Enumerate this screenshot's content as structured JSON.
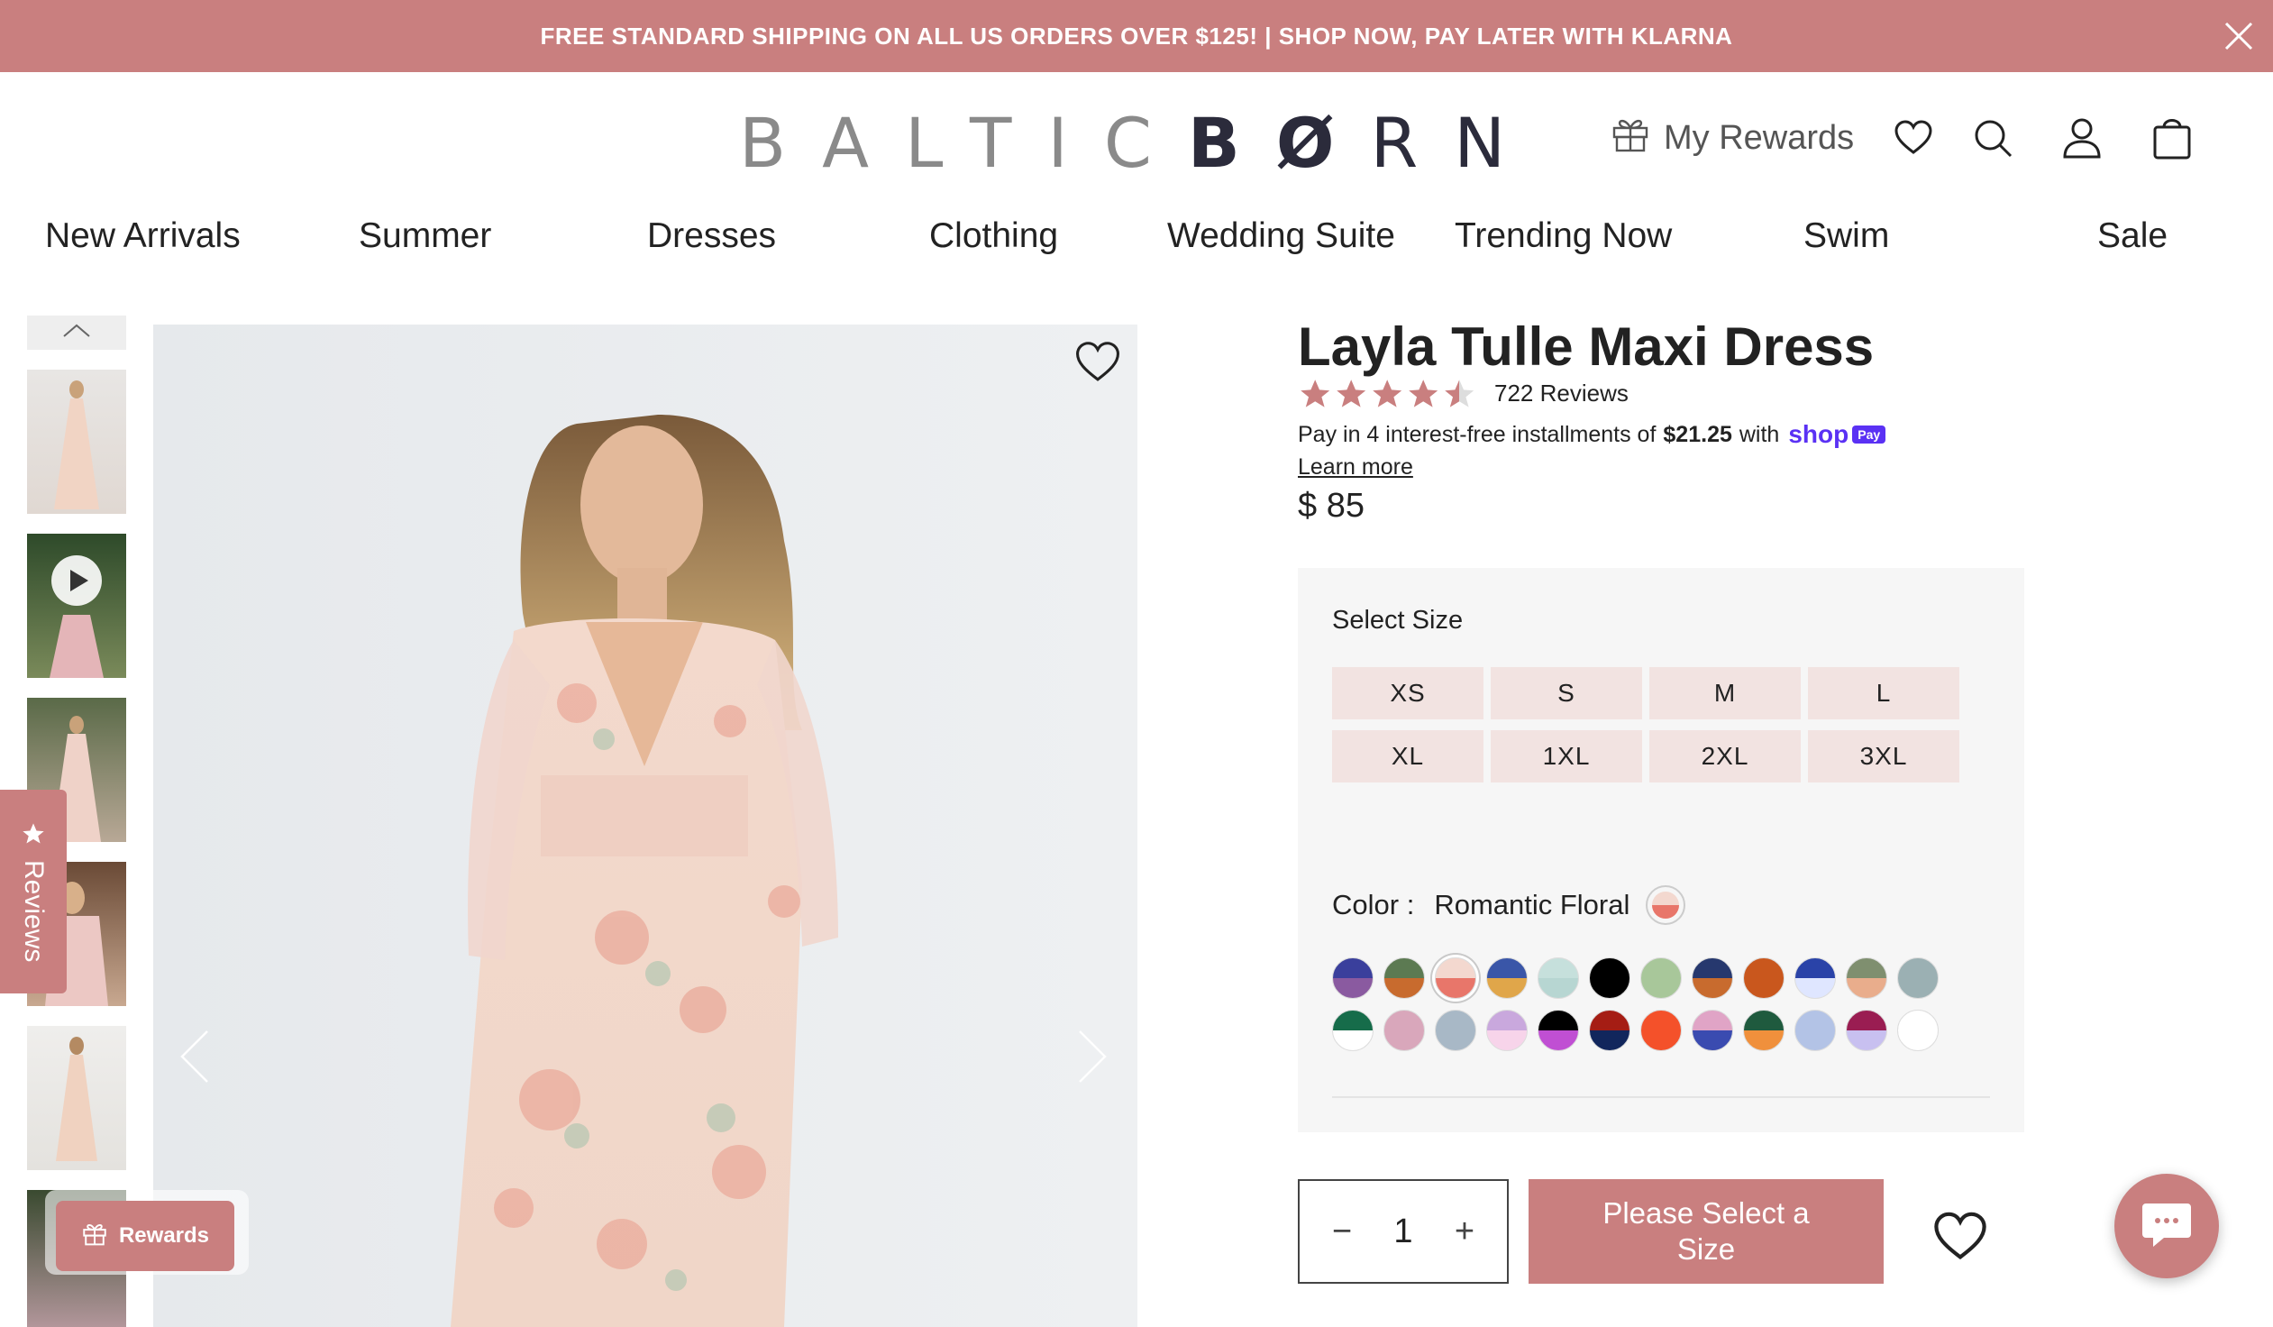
{
  "announcement": {
    "text": "FREE STANDARD SHIPPING ON ALL US ORDERS OVER $125! | SHOP NOW, PAY LATER WITH KLARNA",
    "bg_color": "#c97f7f"
  },
  "header": {
    "logo_light": "BALTIC",
    "logo_dark_1": "B",
    "logo_dark_2": "Ø",
    "logo_dark_3": "R",
    "logo_dark_4": "N",
    "rewards_label": "My Rewards",
    "icons": [
      "gift-icon",
      "heart-icon",
      "search-icon",
      "account-icon",
      "bag-icon"
    ]
  },
  "nav": {
    "items": [
      "New Arrivals",
      "Summer",
      "Dresses",
      "Clothing",
      "Wedding Suite",
      "Trending Now",
      "Swim",
      "Sale"
    ]
  },
  "reviews_tab": {
    "label": "Reviews"
  },
  "rewards_float": {
    "label": "Rewards"
  },
  "product": {
    "title": "Layla Tulle Maxi Dress",
    "rating": 4.5,
    "reviews_label": "722 Reviews",
    "installments_pre": "Pay in 4 interest-free installments of",
    "installments_amount": "$21.25",
    "installments_post": "with",
    "shop_logo": "shop",
    "shop_pay_badge": "Pay",
    "learn_more": "Learn more",
    "price": "$ 85"
  },
  "options": {
    "select_size_label": "Select Size",
    "sizes": [
      "XS",
      "S",
      "M",
      "L",
      "XL",
      "1XL",
      "2XL",
      "3XL"
    ],
    "color_label": "Color :",
    "color_value": "Romantic Floral",
    "swatches": [
      {
        "top": "#3a3f9c",
        "bottom": "#8a5aa0"
      },
      {
        "top": "#5c7a52",
        "bottom": "#c86b2e"
      },
      {
        "top": "#f3d8cf",
        "bottom": "#e8766a"
      },
      {
        "top": "#3a56a8",
        "bottom": "#e0a64a"
      },
      {
        "top": "#c6e0dc",
        "bottom": "#b7d6d2"
      },
      {
        "top": "#000000",
        "bottom": "#000000"
      },
      {
        "top": "#a8c79a",
        "bottom": "#a8c79a"
      },
      {
        "top": "#26386e",
        "bottom": "#c86b2e"
      },
      {
        "top": "#c9571d",
        "bottom": "#c9571d"
      },
      {
        "top": "#2a43a8",
        "bottom": "#dfe6ff"
      },
      {
        "top": "#7f8f6f",
        "bottom": "#e9ad8c"
      },
      {
        "top": "#9bb0b3",
        "bottom": "#9bb0b3"
      },
      {
        "top": "#166c4a",
        "bottom": "#ffffff"
      },
      {
        "top": "#d9a7bb",
        "bottom": "#d9a7bb"
      },
      {
        "top": "#a8b8c6",
        "bottom": "#a8b8c6"
      },
      {
        "top": "#c9a8dd",
        "bottom": "#f7d4ea"
      },
      {
        "top": "#000000",
        "bottom": "#c04fd3"
      },
      {
        "top": "#a51d14",
        "bottom": "#11265c"
      },
      {
        "top": "#f4512a",
        "bottom": "#f4512a"
      },
      {
        "top": "#e0a4c6",
        "bottom": "#3a4bb0"
      },
      {
        "top": "#1f5a3e",
        "bottom": "#f0903c"
      },
      {
        "top": "#b3c3e6",
        "bottom": "#b3c3e6"
      },
      {
        "top": "#9a1d52",
        "bottom": "#c8c0f0"
      },
      {
        "top": "#ffffff",
        "bottom": "#ffffff"
      }
    ],
    "active_swatch_index": 2
  },
  "cart": {
    "qty_minus": "−",
    "qty_value": "1",
    "qty_plus": "+",
    "add_label": "Please Select a Size"
  }
}
